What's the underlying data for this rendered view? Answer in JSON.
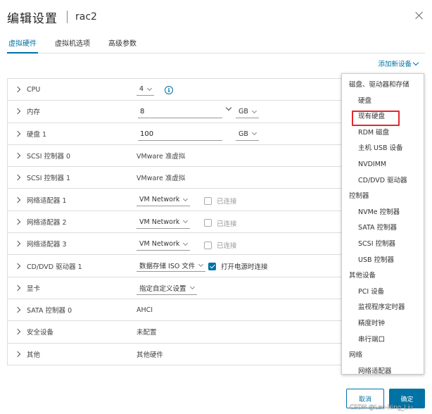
{
  "dialog": {
    "title": "编辑设置",
    "subtitle": "rac2",
    "close_icon": "close-icon"
  },
  "tabs": [
    {
      "label": "虚拟硬件",
      "active": true
    },
    {
      "label": "虚拟机选项",
      "active": false
    },
    {
      "label": "高级参数",
      "active": false
    }
  ],
  "add_device": {
    "label": "添加新设备"
  },
  "hardware": {
    "cpu": {
      "label": "CPU",
      "value": "4"
    },
    "memory": {
      "label": "内存",
      "value": "8",
      "unit": "GB"
    },
    "disk1": {
      "label": "硬盘 1",
      "value": "100",
      "unit": "GB"
    },
    "scsi0": {
      "label": "SCSI 控制器 0",
      "value": "VMware 准虚拟"
    },
    "scsi1": {
      "label": "SCSI 控制器 1",
      "value": "VMware 准虚拟"
    },
    "net1": {
      "label": "网络适配器 1",
      "value": "VM Network",
      "check_label": "已连接",
      "checked": false
    },
    "net2": {
      "label": "网络适配器 2",
      "value": "VM Network",
      "check_label": "已连接",
      "checked": false
    },
    "net3": {
      "label": "网络适配器 3",
      "value": "VM Network",
      "check_label": "已连接",
      "checked": false
    },
    "cdrom1": {
      "label": "CD/DVD 驱动器 1",
      "value": "数据存储 ISO 文件",
      "check_label": "打开电源时连接",
      "checked": true
    },
    "video": {
      "label": "显卡",
      "value": "指定自定义设置"
    },
    "sata0": {
      "label": "SATA 控制器 0",
      "value": "AHCI"
    },
    "security": {
      "label": "安全设备",
      "value": "未配置"
    },
    "other": {
      "label": "其他",
      "value": "其他硬件"
    }
  },
  "menu": {
    "group_storage": "磁盘、驱动器和存储",
    "item_disk": "硬盘",
    "item_existing_disk": "现有硬盘",
    "item_rdm": "RDM 磁盘",
    "item_usb": "主机 USB 设备",
    "item_nvdimm": "NVDIMM",
    "item_cddvd": "CD/DVD 驱动器",
    "group_controllers": "控制器",
    "item_nvme": "NVMe 控制器",
    "item_sata": "SATA 控制器",
    "item_scsi": "SCSI 控制器",
    "item_usbctl": "USB 控制器",
    "group_other": "其他设备",
    "item_pci": "PCI 设备",
    "item_watchdog": "监视程序定时器",
    "item_clock": "精度时钟",
    "item_serial": "串行端口",
    "group_network": "网络",
    "item_netadapter": "网络适配器",
    "highlight_color": "#e8262a"
  },
  "buttons": {
    "cancel": "取消",
    "ok": "确定"
  },
  "colors": {
    "accent": "#0072a3"
  },
  "watermark": "CSDN @Leo-Ning_Liu"
}
